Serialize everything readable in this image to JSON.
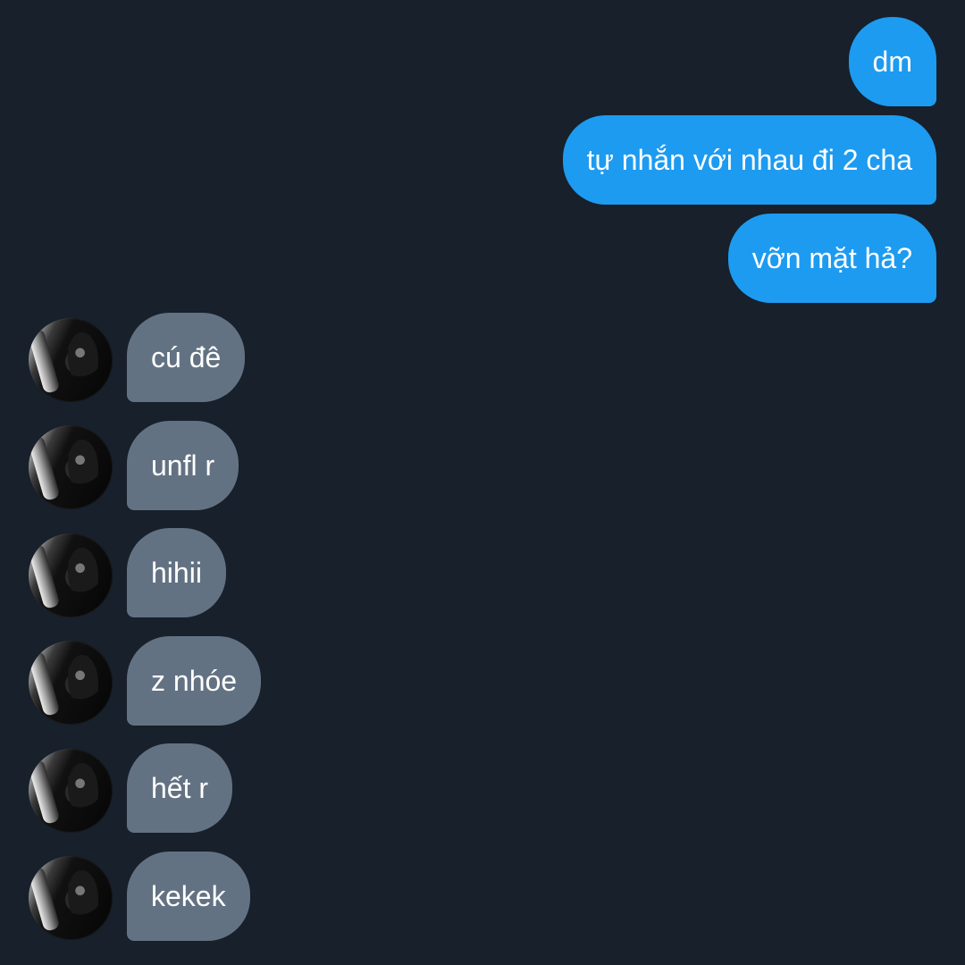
{
  "conversation": {
    "sent_messages": [
      {
        "text": "dm"
      },
      {
        "text": "tự nhắn với nhau đi 2 cha"
      },
      {
        "text": "vỡn mặt hả?"
      }
    ],
    "received_messages": [
      {
        "text": "cú đê",
        "avatar_icon": "profile-photo"
      },
      {
        "text": "unfl r",
        "avatar_icon": "profile-photo"
      },
      {
        "text": "hihii",
        "avatar_icon": "profile-photo"
      },
      {
        "text": "z nhóe",
        "avatar_icon": "profile-photo"
      },
      {
        "text": "hết r",
        "avatar_icon": "profile-photo"
      },
      {
        "text": "kekek",
        "avatar_icon": "profile-photo"
      }
    ]
  },
  "colors": {
    "background": "#17202b",
    "sent_bubble": "#1d9bf0",
    "received_bubble": "#637283",
    "text": "#ffffff"
  }
}
